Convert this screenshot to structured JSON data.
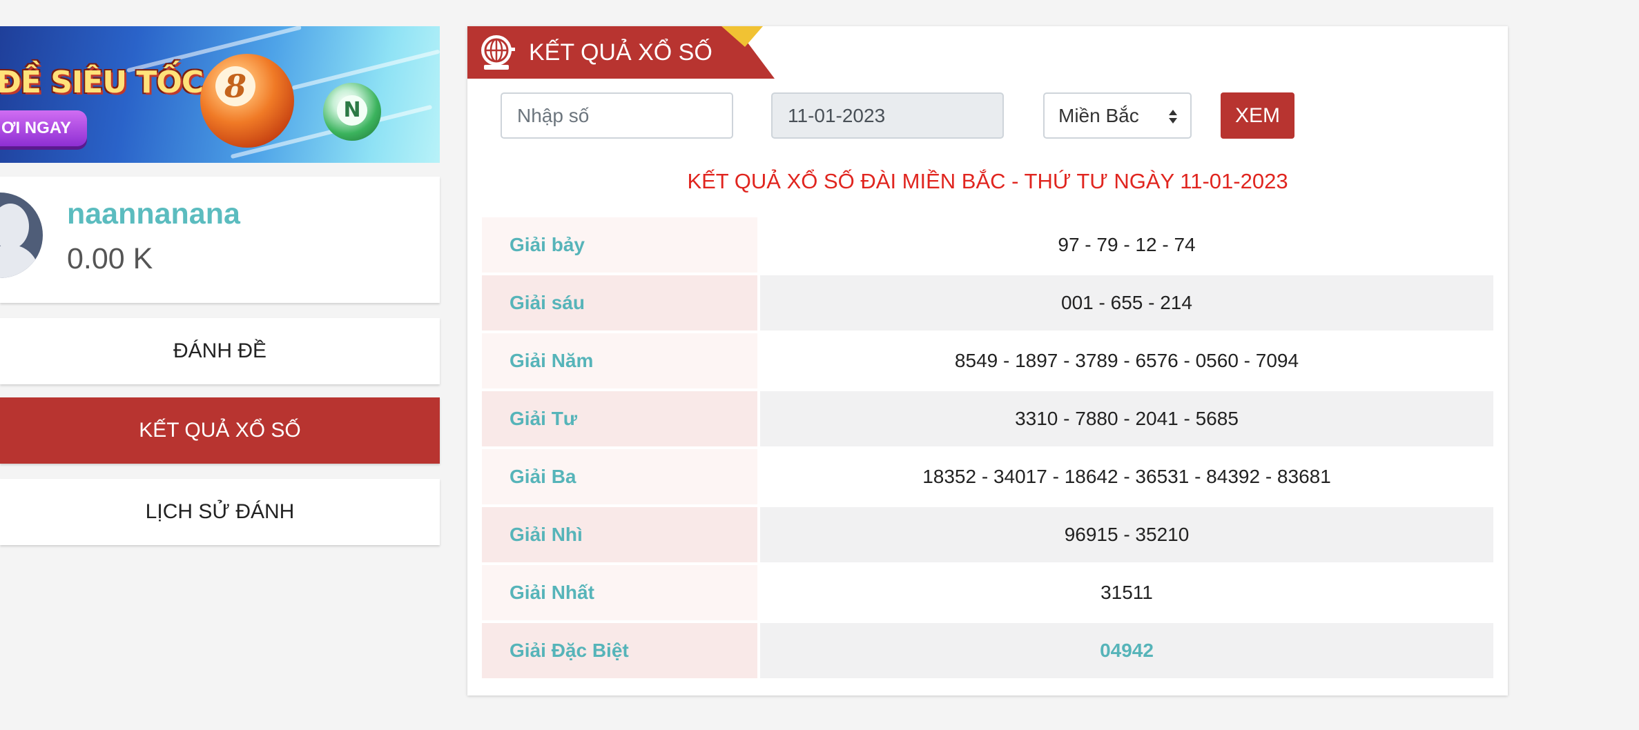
{
  "banner": {
    "title": "ĐỀ SIÊU TỐC",
    "button_label": "ƠI NGAY",
    "ball_number_1": "8",
    "ball_number_2": "N"
  },
  "user": {
    "username": "naannanana",
    "balance": "0.00 K"
  },
  "menu": {
    "items": [
      {
        "label": "ĐÁNH ĐỀ",
        "active": false
      },
      {
        "label": "KẾT QUẢ XỔ SỐ",
        "active": true
      },
      {
        "label": "LỊCH SỬ ĐÁNH",
        "active": false
      }
    ]
  },
  "panel": {
    "title": "KẾT QUẢ XỔ SỐ",
    "icon": "lottery-cage-icon",
    "search": {
      "number_placeholder": "Nhập số",
      "number_value": "",
      "date_value": "11-01-2023",
      "region_selected": "Miền Bắc",
      "submit_label": "XEM"
    },
    "heading": "KẾT QUẢ XỔ SỐ ĐÀI MIỀN BẮC - THỨ TƯ NGÀY 11-01-2023",
    "results": [
      {
        "prize": "Giải bảy",
        "numbers": "97 - 79 - 12 - 74"
      },
      {
        "prize": "Giải sáu",
        "numbers": "001 - 655 - 214"
      },
      {
        "prize": "Giải Năm",
        "numbers": "8549 - 1897 - 3789 - 6576 - 0560 - 7094"
      },
      {
        "prize": "Giải Tư",
        "numbers": "3310 - 7880 - 2041 - 5685"
      },
      {
        "prize": "Giải Ba",
        "numbers": "18352 - 34017 - 18642 - 36531 - 84392 - 83681"
      },
      {
        "prize": "Giải Nhì",
        "numbers": "96915 - 35210"
      },
      {
        "prize": "Giải Nhất",
        "numbers": "31511"
      },
      {
        "prize": "Giải Đặc Biệt",
        "numbers": "04942"
      }
    ]
  },
  "colors": {
    "brand_red": "#b83430",
    "teal": "#56b4b9",
    "heading_red": "#e0251f",
    "ribbon_accent": "#f1c233"
  }
}
